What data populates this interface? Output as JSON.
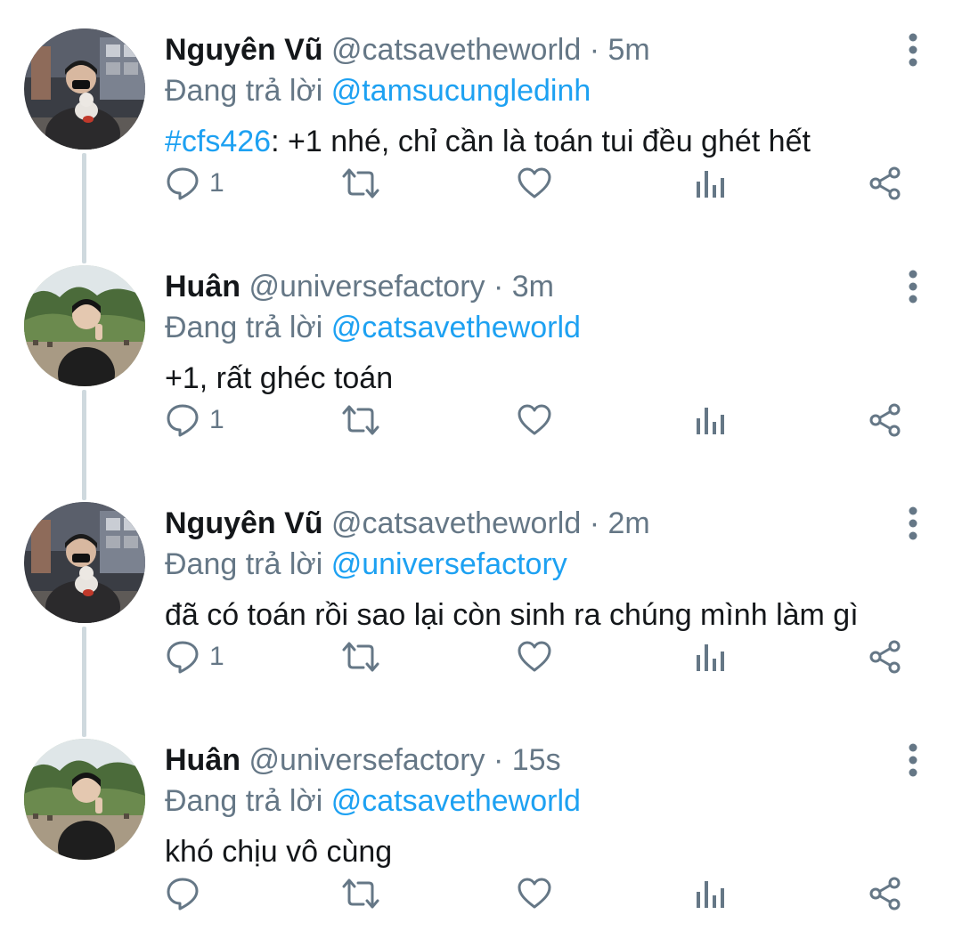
{
  "colors": {
    "link": "#1da1f2",
    "muted": "#657786",
    "text": "#14171a",
    "thread_line": "#cfd9de"
  },
  "tweets": [
    {
      "name": "Nguyên Vũ",
      "handle": "@catsavetheworld",
      "separator": "·",
      "time": "5m",
      "reply_prefix": "Đang trả lời",
      "reply_to": "@tamsucungledinh",
      "hashtag": "#cfs426",
      "text": ": +1 nhé, chỉ cần là toán tui đều ghét hết",
      "reply_count": "1",
      "avatar_icon": "profile-photo-person-holding-cat",
      "more_icon": "vertical-ellipsis-icon"
    },
    {
      "name": "Huân",
      "handle": "@universefactory",
      "separator": "·",
      "time": "3m",
      "reply_prefix": "Đang trả lời",
      "reply_to": "@catsavetheworld",
      "text": "+1, rất ghéc toán",
      "reply_count": "1",
      "avatar_icon": "profile-photo-person-outdoors",
      "more_icon": "vertical-ellipsis-icon"
    },
    {
      "name": "Nguyên Vũ",
      "handle": "@catsavetheworld",
      "separator": "·",
      "time": "2m",
      "reply_prefix": "Đang trả lời",
      "reply_to": "@universefactory",
      "text": "đã có toán rồi sao lại còn sinh ra chúng mình làm gì",
      "reply_count": "1",
      "avatar_icon": "profile-photo-person-holding-cat",
      "more_icon": "vertical-ellipsis-icon"
    },
    {
      "name": "Huân",
      "handle": "@universefactory",
      "separator": "·",
      "time": "15s",
      "reply_prefix": "Đang trả lời",
      "reply_to": "@catsavetheworld",
      "text": "khó chịu vô cùng",
      "reply_count": "",
      "avatar_icon": "profile-photo-person-outdoors",
      "more_icon": "vertical-ellipsis-icon"
    }
  ],
  "action_icons": [
    "reply-icon",
    "retweet-icon",
    "like-icon",
    "analytics-icon",
    "share-icon"
  ]
}
